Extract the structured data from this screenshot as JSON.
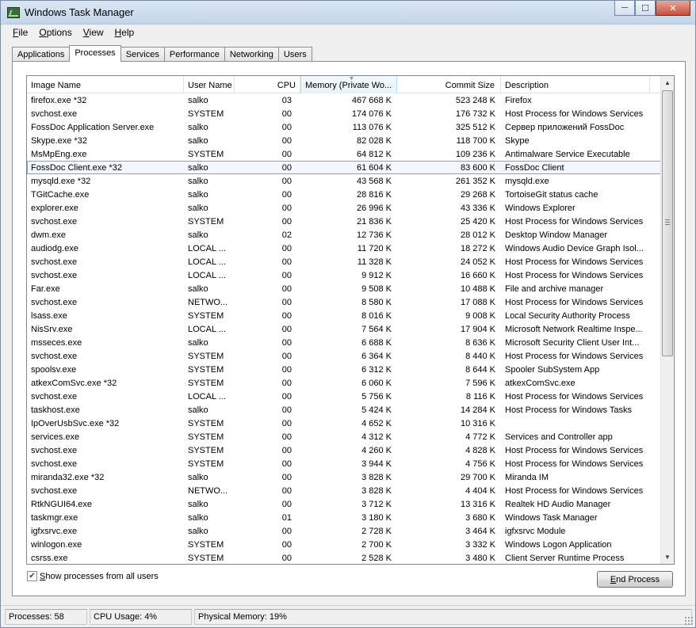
{
  "window": {
    "title": "Windows Task Manager"
  },
  "menu": [
    {
      "key": "F",
      "rest": "ile"
    },
    {
      "key": "O",
      "rest": "ptions"
    },
    {
      "key": "V",
      "rest": "iew"
    },
    {
      "key": "H",
      "rest": "elp"
    }
  ],
  "tabs": [
    "Applications",
    "Processes",
    "Services",
    "Performance",
    "Networking",
    "Users"
  ],
  "active_tab": "Processes",
  "columns": {
    "name": "Image Name",
    "user": "User Name",
    "cpu": "CPU",
    "memory": "Memory (Private Wo...",
    "commit": "Commit Size",
    "description": "Description"
  },
  "sorted_column": "memory",
  "processes": [
    [
      "firefox.exe *32",
      "salko",
      "03",
      "467 668 K",
      "523 248 K",
      "Firefox"
    ],
    [
      "svchost.exe",
      "SYSTEM",
      "00",
      "174 076 K",
      "176 732 K",
      "Host Process for Windows Services"
    ],
    [
      "FossDoc Application Server.exe",
      "salko",
      "00",
      "113 076 K",
      "325 512 K",
      "Сервер приложений FossDoc"
    ],
    [
      "Skype.exe *32",
      "salko",
      "00",
      "82 028 K",
      "118 700 K",
      "Skype"
    ],
    [
      "MsMpEng.exe",
      "SYSTEM",
      "00",
      "64 812 K",
      "109 236 K",
      "Antimalware Service Executable"
    ],
    [
      "FossDoc Client.exe *32",
      "salko",
      "00",
      "61 604 K",
      "83 600 K",
      "FossDoc Client"
    ],
    [
      "mysqld.exe *32",
      "salko",
      "00",
      "43 568 K",
      "261 352 K",
      "mysqld.exe"
    ],
    [
      "TGitCache.exe",
      "salko",
      "00",
      "28 816 K",
      "29 268 K",
      "TortoiseGit status cache"
    ],
    [
      "explorer.exe",
      "salko",
      "00",
      "26 996 K",
      "43 336 K",
      "Windows Explorer"
    ],
    [
      "svchost.exe",
      "SYSTEM",
      "00",
      "21 836 K",
      "25 420 K",
      "Host Process for Windows Services"
    ],
    [
      "dwm.exe",
      "salko",
      "02",
      "12 736 K",
      "28 012 K",
      "Desktop Window Manager"
    ],
    [
      "audiodg.exe",
      "LOCAL ...",
      "00",
      "11 720 K",
      "18 272 K",
      "Windows Audio Device Graph Isol..."
    ],
    [
      "svchost.exe",
      "LOCAL ...",
      "00",
      "11 328 K",
      "24 052 K",
      "Host Process for Windows Services"
    ],
    [
      "svchost.exe",
      "LOCAL ...",
      "00",
      "9 912 K",
      "16 660 K",
      "Host Process for Windows Services"
    ],
    [
      "Far.exe",
      "salko",
      "00",
      "9 508 K",
      "10 488 K",
      "File and archive manager"
    ],
    [
      "svchost.exe",
      "NETWO...",
      "00",
      "8 580 K",
      "17 088 K",
      "Host Process for Windows Services"
    ],
    [
      "lsass.exe",
      "SYSTEM",
      "00",
      "8 016 K",
      "9 008 K",
      "Local Security Authority Process"
    ],
    [
      "NisSrv.exe",
      "LOCAL ...",
      "00",
      "7 564 K",
      "17 904 K",
      "Microsoft Network Realtime Inspe..."
    ],
    [
      "msseces.exe",
      "salko",
      "00",
      "6 688 K",
      "8 636 K",
      "Microsoft Security Client User Int..."
    ],
    [
      "svchost.exe",
      "SYSTEM",
      "00",
      "6 364 K",
      "8 440 K",
      "Host Process for Windows Services"
    ],
    [
      "spoolsv.exe",
      "SYSTEM",
      "00",
      "6 312 K",
      "8 644 K",
      "Spooler SubSystem App"
    ],
    [
      "atkexComSvc.exe *32",
      "SYSTEM",
      "00",
      "6 060 K",
      "7 596 K",
      "atkexComSvc.exe"
    ],
    [
      "svchost.exe",
      "LOCAL ...",
      "00",
      "5 756 K",
      "8 116 K",
      "Host Process for Windows Services"
    ],
    [
      "taskhost.exe",
      "salko",
      "00",
      "5 424 K",
      "14 284 K",
      "Host Process for Windows Tasks"
    ],
    [
      "IpOverUsbSvc.exe *32",
      "SYSTEM",
      "00",
      "4 652 K",
      "10 316 K",
      ""
    ],
    [
      "services.exe",
      "SYSTEM",
      "00",
      "4 312 K",
      "4 772 K",
      "Services and Controller app"
    ],
    [
      "svchost.exe",
      "SYSTEM",
      "00",
      "4 260 K",
      "4 828 K",
      "Host Process for Windows Services"
    ],
    [
      "svchost.exe",
      "SYSTEM",
      "00",
      "3 944 K",
      "4 756 K",
      "Host Process for Windows Services"
    ],
    [
      "miranda32.exe *32",
      "salko",
      "00",
      "3 828 K",
      "29 700 K",
      "Miranda IM"
    ],
    [
      "svchost.exe",
      "NETWO...",
      "00",
      "3 828 K",
      "4 404 K",
      "Host Process for Windows Services"
    ],
    [
      "RtkNGUI64.exe",
      "salko",
      "00",
      "3 712 K",
      "13 316 K",
      "Realtek HD Audio Manager"
    ],
    [
      "taskmgr.exe",
      "salko",
      "01",
      "3 180 K",
      "3 680 K",
      "Windows Task Manager"
    ],
    [
      "igfxsrvc.exe",
      "salko",
      "00",
      "2 728 K",
      "3 464 K",
      "igfxsrvc Module"
    ],
    [
      "winlogon.exe",
      "SYSTEM",
      "00",
      "2 700 K",
      "3 332 K",
      "Windows Logon Application"
    ],
    [
      "csrss.exe",
      "SYSTEM",
      "00",
      "2 528 K",
      "3 480 K",
      "Client Server Runtime Process"
    ]
  ],
  "selected_row": 5,
  "show_all_users": {
    "key": "S",
    "rest": "how processes from all users",
    "checked": true
  },
  "end_process": {
    "key": "E",
    "rest": "nd Process"
  },
  "status": {
    "processes": "Processes: 58",
    "cpu": "CPU Usage: 4%",
    "memory": "Physical Memory: 19%"
  },
  "icons": {
    "app": "task-manager-icon",
    "minimize": "minimize-icon",
    "maximize": "maximize-icon",
    "close": "close-icon"
  }
}
